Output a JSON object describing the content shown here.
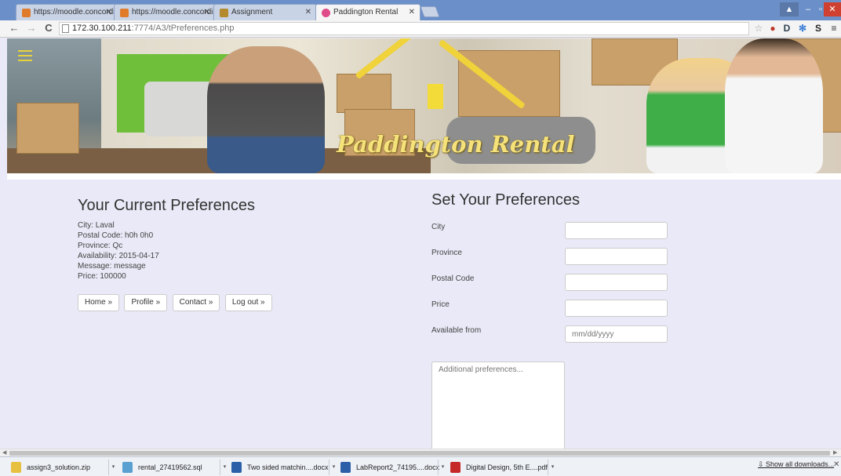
{
  "browser": {
    "tabs": [
      {
        "title": "https://moodle.concordia",
        "favicon_color": "#e07b2a",
        "active": false
      },
      {
        "title": "https://moodle.concordia",
        "favicon_color": "#e07b2a",
        "active": false
      },
      {
        "title": "Assignment",
        "favicon_color": "#b58a2e",
        "active": false
      },
      {
        "title": "Paddington Rental",
        "favicon_color": "#e04c8a",
        "active": true
      }
    ],
    "url_host": "172.30.100.211",
    "url_path": ":7774/A3/tPreferences.php"
  },
  "banner": {
    "logo_text": "Paddington Rental"
  },
  "current": {
    "title": "Your Current Preferences",
    "lines": [
      "City: Laval",
      "Postal Code: h0h 0h0",
      "Province: Qc",
      "Availability: 2015-04-17",
      "Message: message",
      "Price: 100000"
    ],
    "buttons": [
      "Home »",
      "Profile »",
      "Contact »",
      "Log out »"
    ]
  },
  "form": {
    "title": "Set Your Preferences",
    "fields": [
      {
        "label": "City",
        "placeholder": ""
      },
      {
        "label": "Province",
        "placeholder": ""
      },
      {
        "label": "Postal Code",
        "placeholder": ""
      },
      {
        "label": "Price",
        "placeholder": ""
      },
      {
        "label": "Available from",
        "placeholder": "mm/dd/yyyy"
      }
    ],
    "textarea_placeholder": "Additional preferences..."
  },
  "downloads": {
    "items": [
      {
        "name": "assign3_solution.zip",
        "icon_color": "#e8c040"
      },
      {
        "name": "rental_27419562.sql",
        "icon_color": "#5aa0d0"
      },
      {
        "name": "Two sided matchin....docx",
        "icon_color": "#2b5fa8"
      },
      {
        "name": "LabReport2_74195....docx",
        "icon_color": "#2b5fa8"
      },
      {
        "name": "Digital Design, 5th E....pdf",
        "icon_color": "#c62828"
      }
    ],
    "show_all": "Show all downloads..."
  }
}
